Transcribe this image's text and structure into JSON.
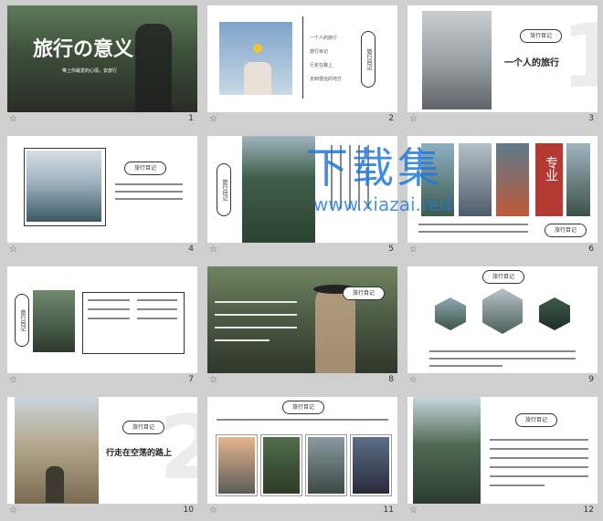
{
  "slides": [
    {
      "num": "1",
      "title": "旅行の意义",
      "subtitle": "带上你最爱的心情，去旅行"
    },
    {
      "num": "2",
      "menu": [
        "一个人的旅行",
        "旅行目记",
        "行走在路上",
        "去到很远的地方"
      ],
      "circ": "旅行目记"
    },
    {
      "num": "3",
      "heading": "旅行目记",
      "title": "一个人的旅行",
      "big": "1"
    },
    {
      "num": "4",
      "heading": "旅行目记"
    },
    {
      "num": "5",
      "circ": "旅行目记"
    },
    {
      "num": "6",
      "stamp": "专业",
      "heading": "旅行目记"
    },
    {
      "num": "7",
      "circ": "旅行目记"
    },
    {
      "num": "8",
      "heading": "旅行目记"
    },
    {
      "num": "9",
      "heading": "旅行目记"
    },
    {
      "num": "10",
      "heading": "旅行目记",
      "title": "行走在空荡的路上",
      "big": "2"
    },
    {
      "num": "11",
      "heading": "旅行目记"
    },
    {
      "num": "12",
      "heading": "旅行目记"
    }
  ],
  "watermark": {
    "line1": "下载集",
    "line2": "www.xiazai.red"
  },
  "star": "☆"
}
